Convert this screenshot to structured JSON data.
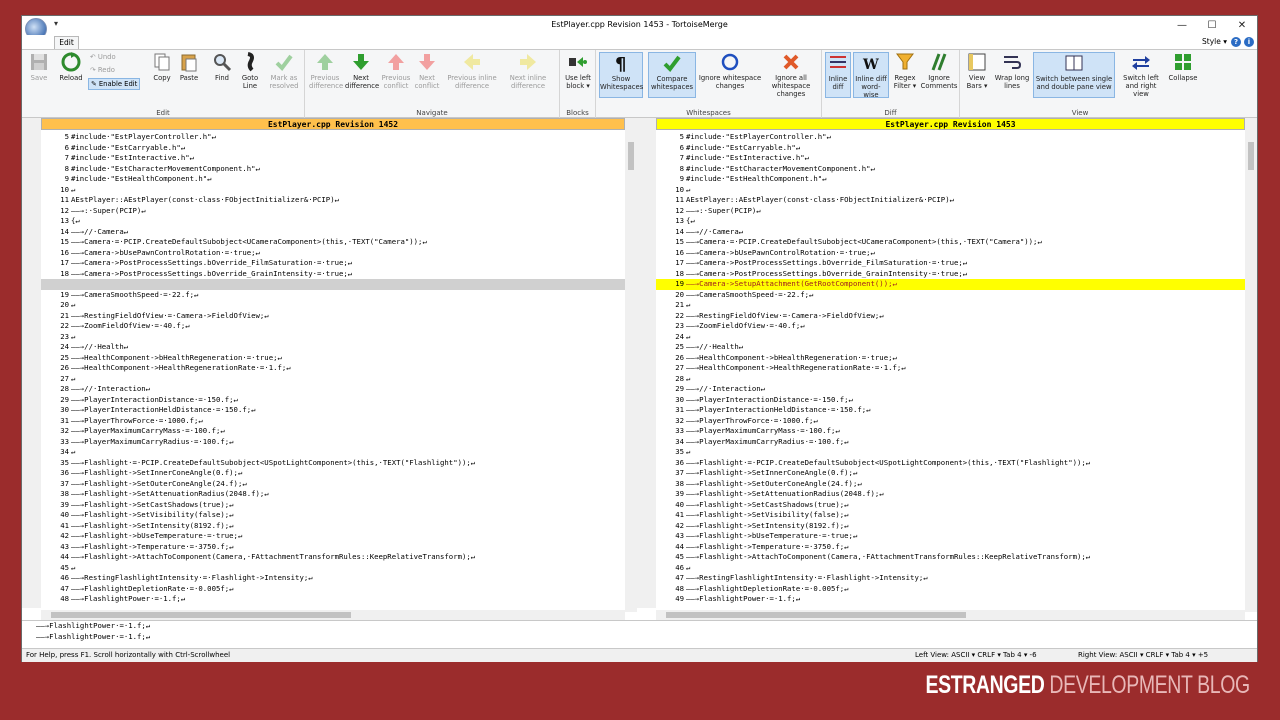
{
  "window": {
    "title": "EstPlayer.cpp Revision 1453 - TortoiseMerge",
    "qat": "▾",
    "min": "—",
    "max": "☐",
    "close": "✕"
  },
  "ribbon_tabs": {
    "edit": "Edit",
    "style": "Style ▾"
  },
  "ribbon": {
    "groups": {
      "edit": "Edit",
      "navigate": "Navigate",
      "blocks": "Blocks",
      "whitespaces": "Whitespaces",
      "diff": "Diff",
      "view": "View"
    },
    "save": "Save",
    "reload": "Reload",
    "undo": "Undo",
    "redo": "Redo",
    "enable_edit": "Enable Edit",
    "copy": "Copy",
    "paste": "Paste",
    "find": "Find",
    "goto": "Goto Line",
    "mark": "Mark as resolved",
    "prev_diff": "Previous difference",
    "next_diff": "Next difference",
    "prev_conf": "Previous conflict",
    "next_conf": "Next conflict",
    "prev_inline": "Previous inline difference",
    "next_inline": "Next inline difference",
    "use_left": "Use left block ▾",
    "show_ws": "Show Whitespaces",
    "compare_ws": "Compare whitespaces",
    "ignore_ws": "Ignore whitespace changes",
    "ignore_all": "Ignore all whitespace changes",
    "inline_diff": "Inline diff",
    "inline_word": "Inline diff word-wise",
    "regex": "Regex Filter ▾",
    "ignore_comments": "Ignore Comments",
    "view_bars": "View Bars ▾",
    "wrap": "Wrap long lines",
    "switch_single": "Switch between single and double pane view",
    "switch_lr": "Switch left and right view",
    "collapse": "Collapse"
  },
  "left": {
    "title": "EstPlayer.cpp Revision 1452",
    "lines": [
      {
        "n": "5",
        "t": "#include·\"EstPlayerController.h\"↵"
      },
      {
        "n": "6",
        "t": "#include·\"EstCarryable.h\"↵"
      },
      {
        "n": "7",
        "t": "#include·\"EstInteractive.h\"↵"
      },
      {
        "n": "8",
        "t": "#include·\"EstCharacterMovementComponent.h\"↵"
      },
      {
        "n": "9",
        "t": "#include·\"EstHealthComponent.h\"↵"
      },
      {
        "n": "10",
        "t": "↵"
      },
      {
        "n": "11",
        "t": "AEstPlayer::AEstPlayer(const·class·FObjectInitializer&·PCIP)↵"
      },
      {
        "n": "12",
        "t": "——→:·Super(PCIP)↵"
      },
      {
        "n": "13",
        "t": "{↵"
      },
      {
        "n": "14",
        "t": "——→//·Camera↵"
      },
      {
        "n": "15",
        "t": "——→Camera·=·PCIP.CreateDefaultSubobject<UCameraComponent>(this,·TEXT(\"Camera\"));↵"
      },
      {
        "n": "16",
        "t": "——→Camera->bUsePawnControlRotation·=·true;↵"
      },
      {
        "n": "17",
        "t": "——→Camera->PostProcessSettings.bOverride_FilmSaturation·=·true;↵"
      },
      {
        "n": "18",
        "t": "——→Camera->PostProcessSettings.bOverride_GrainIntensity·=·true;↵"
      },
      {
        "n": "",
        "t": "",
        "gap": true
      },
      {
        "n": "19",
        "t": "——→CameraSmoothSpeed·=·22.f;↵"
      },
      {
        "n": "20",
        "t": "↵"
      },
      {
        "n": "21",
        "t": "——→RestingFieldOfView·=·Camera->FieldOfView;↵"
      },
      {
        "n": "22",
        "t": "——→ZoomFieldOfView·=·40.f;↵"
      },
      {
        "n": "23",
        "t": "↵"
      },
      {
        "n": "24",
        "t": "——→//·Health↵"
      },
      {
        "n": "25",
        "t": "——→HealthComponent->bHealthRegeneration·=·true;↵"
      },
      {
        "n": "26",
        "t": "——→HealthComponent->HealthRegenerationRate·=·1.f;↵"
      },
      {
        "n": "27",
        "t": "↵"
      },
      {
        "n": "28",
        "t": "——→//·Interaction↵"
      },
      {
        "n": "29",
        "t": "——→PlayerInteractionDistance·=·150.f;↵"
      },
      {
        "n": "30",
        "t": "——→PlayerInteractionHeldDistance·=·150.f;↵"
      },
      {
        "n": "31",
        "t": "——→PlayerThrowForce·=·1000.f;↵"
      },
      {
        "n": "32",
        "t": "——→PlayerMaximumCarryMass·=·100.f;↵"
      },
      {
        "n": "33",
        "t": "——→PlayerMaximumCarryRadius·=·100.f;↵"
      },
      {
        "n": "34",
        "t": "↵"
      },
      {
        "n": "35",
        "t": "——→Flashlight·=·PCIP.CreateDefaultSubobject<USpotLightComponent>(this,·TEXT(\"Flashlight\"));↵"
      },
      {
        "n": "36",
        "t": "——→Flashlight->SetInnerConeAngle(0.f);↵"
      },
      {
        "n": "37",
        "t": "——→Flashlight->SetOuterConeAngle(24.f);↵"
      },
      {
        "n": "38",
        "t": "——→Flashlight->SetAttenuationRadius(2048.f);↵"
      },
      {
        "n": "39",
        "t": "——→Flashlight->SetCastShadows(true);↵"
      },
      {
        "n": "40",
        "t": "——→Flashlight->SetVisibility(false);↵"
      },
      {
        "n": "41",
        "t": "——→Flashlight->SetIntensity(8192.f);↵"
      },
      {
        "n": "42",
        "t": "——→Flashlight->bUseTemperature·=·true;↵"
      },
      {
        "n": "43",
        "t": "——→Flashlight->Temperature·=·3750.f;↵"
      },
      {
        "n": "44",
        "t": "——→Flashlight->AttachToComponent(Camera,·FAttachmentTransformRules::KeepRelativeTransform);↵"
      },
      {
        "n": "45",
        "t": "↵"
      },
      {
        "n": "46",
        "t": "——→RestingFlashlightIntensity·=·Flashlight->Intensity;↵"
      },
      {
        "n": "47",
        "t": "——→FlashlightDepletionRate·=·0.005f;↵"
      },
      {
        "n": "48",
        "t": "——→FlashlightPower·=·1.f;↵"
      }
    ]
  },
  "right": {
    "title": "EstPlayer.cpp Revision 1453",
    "lines": [
      {
        "n": "5",
        "t": "#include·\"EstPlayerController.h\"↵"
      },
      {
        "n": "6",
        "t": "#include·\"EstCarryable.h\"↵"
      },
      {
        "n": "7",
        "t": "#include·\"EstInteractive.h\"↵"
      },
      {
        "n": "8",
        "t": "#include·\"EstCharacterMovementComponent.h\"↵"
      },
      {
        "n": "9",
        "t": "#include·\"EstHealthComponent.h\"↵"
      },
      {
        "n": "10",
        "t": "↵"
      },
      {
        "n": "11",
        "t": "AEstPlayer::AEstPlayer(const·class·FObjectInitializer&·PCIP)↵"
      },
      {
        "n": "12",
        "t": "——→:·Super(PCIP)↵"
      },
      {
        "n": "13",
        "t": "{↵"
      },
      {
        "n": "14",
        "t": "——→//·Camera↵"
      },
      {
        "n": "15",
        "t": "——→Camera·=·PCIP.CreateDefaultSubobject<UCameraComponent>(this,·TEXT(\"Camera\"));↵"
      },
      {
        "n": "16",
        "t": "——→Camera->bUsePawnControlRotation·=·true;↵"
      },
      {
        "n": "17",
        "t": "——→Camera->PostProcessSettings.bOverride_FilmSaturation·=·true;↵"
      },
      {
        "n": "18",
        "t": "——→Camera->PostProcessSettings.bOverride_GrainIntensity·=·true;↵"
      },
      {
        "n": "19",
        "t": "——→Camera->SetupAttachment(GetRootComponent());↵",
        "added": true
      },
      {
        "n": "20",
        "t": "——→CameraSmoothSpeed·=·22.f;↵"
      },
      {
        "n": "21",
        "t": "↵"
      },
      {
        "n": "22",
        "t": "——→RestingFieldOfView·=·Camera->FieldOfView;↵"
      },
      {
        "n": "23",
        "t": "——→ZoomFieldOfView·=·40.f;↵"
      },
      {
        "n": "24",
        "t": "↵"
      },
      {
        "n": "25",
        "t": "——→//·Health↵"
      },
      {
        "n": "26",
        "t": "——→HealthComponent->bHealthRegeneration·=·true;↵"
      },
      {
        "n": "27",
        "t": "——→HealthComponent->HealthRegenerationRate·=·1.f;↵"
      },
      {
        "n": "28",
        "t": "↵"
      },
      {
        "n": "29",
        "t": "——→//·Interaction↵"
      },
      {
        "n": "30",
        "t": "——→PlayerInteractionDistance·=·150.f;↵"
      },
      {
        "n": "31",
        "t": "——→PlayerInteractionHeldDistance·=·150.f;↵"
      },
      {
        "n": "32",
        "t": "——→PlayerThrowForce·=·1000.f;↵"
      },
      {
        "n": "33",
        "t": "——→PlayerMaximumCarryMass·=·100.f;↵"
      },
      {
        "n": "34",
        "t": "——→PlayerMaximumCarryRadius·=·100.f;↵"
      },
      {
        "n": "35",
        "t": "↵"
      },
      {
        "n": "36",
        "t": "——→Flashlight·=·PCIP.CreateDefaultSubobject<USpotLightComponent>(this,·TEXT(\"Flashlight\"));↵"
      },
      {
        "n": "37",
        "t": "——→Flashlight->SetInnerConeAngle(0.f);↵"
      },
      {
        "n": "38",
        "t": "——→Flashlight->SetOuterConeAngle(24.f);↵"
      },
      {
        "n": "39",
        "t": "——→Flashlight->SetAttenuationRadius(2048.f);↵"
      },
      {
        "n": "40",
        "t": "——→Flashlight->SetCastShadows(true);↵"
      },
      {
        "n": "41",
        "t": "——→Flashlight->SetVisibility(false);↵"
      },
      {
        "n": "42",
        "t": "——→Flashlight->SetIntensity(8192.f);↵"
      },
      {
        "n": "43",
        "t": "——→Flashlight->bUseTemperature·=·true;↵"
      },
      {
        "n": "44",
        "t": "——→Flashlight->Temperature·=·3750.f;↵"
      },
      {
        "n": "45",
        "t": "——→Flashlight->AttachToComponent(Camera,·FAttachmentTransformRules::KeepRelativeTransform);↵"
      },
      {
        "n": "46",
        "t": "↵"
      },
      {
        "n": "47",
        "t": "——→RestingFlashlightIntensity·=·Flashlight->Intensity;↵"
      },
      {
        "n": "48",
        "t": "——→FlashlightDepletionRate·=·0.005f;↵"
      },
      {
        "n": "49",
        "t": "——→FlashlightPower·=·1.f;↵"
      }
    ]
  },
  "bottom": {
    "line1": "——→FlashlightPower·=·1.f;↵",
    "line2": "——→FlashlightPower·=·1.f;↵"
  },
  "status": {
    "help": "For Help, press F1. Scroll horizontally with Ctrl-Scrollwheel",
    "left": "Left View:   ASCII ▾   CRLF ▾   Tab 4 ▾   -6",
    "right": "Right View:   ASCII ▾   CRLF ▾   Tab 4 ▾   +5"
  },
  "brand": {
    "a": "ESTRANGED",
    "b": " DEVELOPMENT BLOG"
  },
  "colors": {
    "left_header": "#ffc04c",
    "right_header": "#ffff00",
    "added_line": "#ffff00",
    "gap": "#d0d0d0",
    "background": "#9b2c2c"
  }
}
